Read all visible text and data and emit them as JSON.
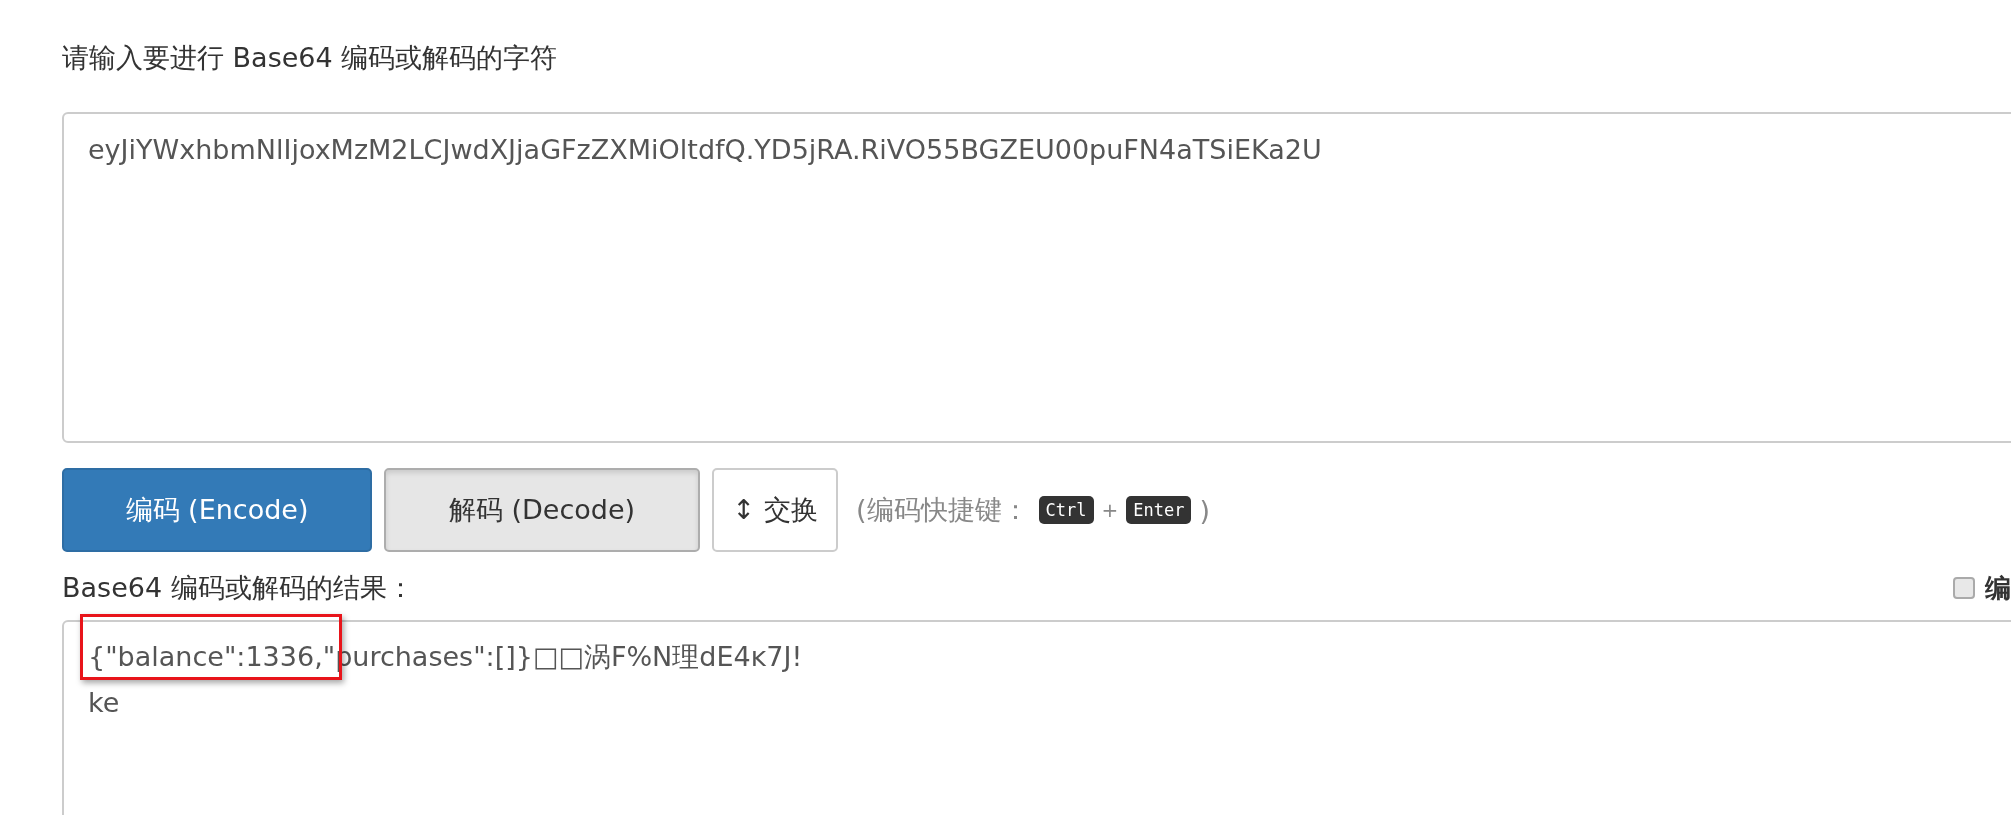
{
  "input": {
    "label": "请输入要进行 Base64 编码或解码的字符",
    "value": "eyJiYWxhbmNlIjoxMzM2LCJwdXJjaGFzZXMiOltdfQ.YD5jRA.RiVO55BGZEU00puFN4aTSiEKa2U"
  },
  "buttons": [
    {
      "kind": "primary",
      "label": "编码 (Encode)"
    },
    {
      "kind": "pressed",
      "label": "解码 (Decode)"
    },
    {
      "kind": "plain",
      "label": "↕ 交换"
    }
  ],
  "hint": {
    "prefix": "(编码快捷键：",
    "keys": [
      "Ctrl",
      "Enter"
    ],
    "joiner": "+",
    "suffix": ")"
  },
  "result": {
    "label": "Base64 编码或解码的结果：",
    "value": "{\"balance\":1336,\"purchases\":[]}□□涡F%N理dE4ĸ7J!\nke",
    "option": {
      "checked": false,
      "label": "编"
    }
  }
}
